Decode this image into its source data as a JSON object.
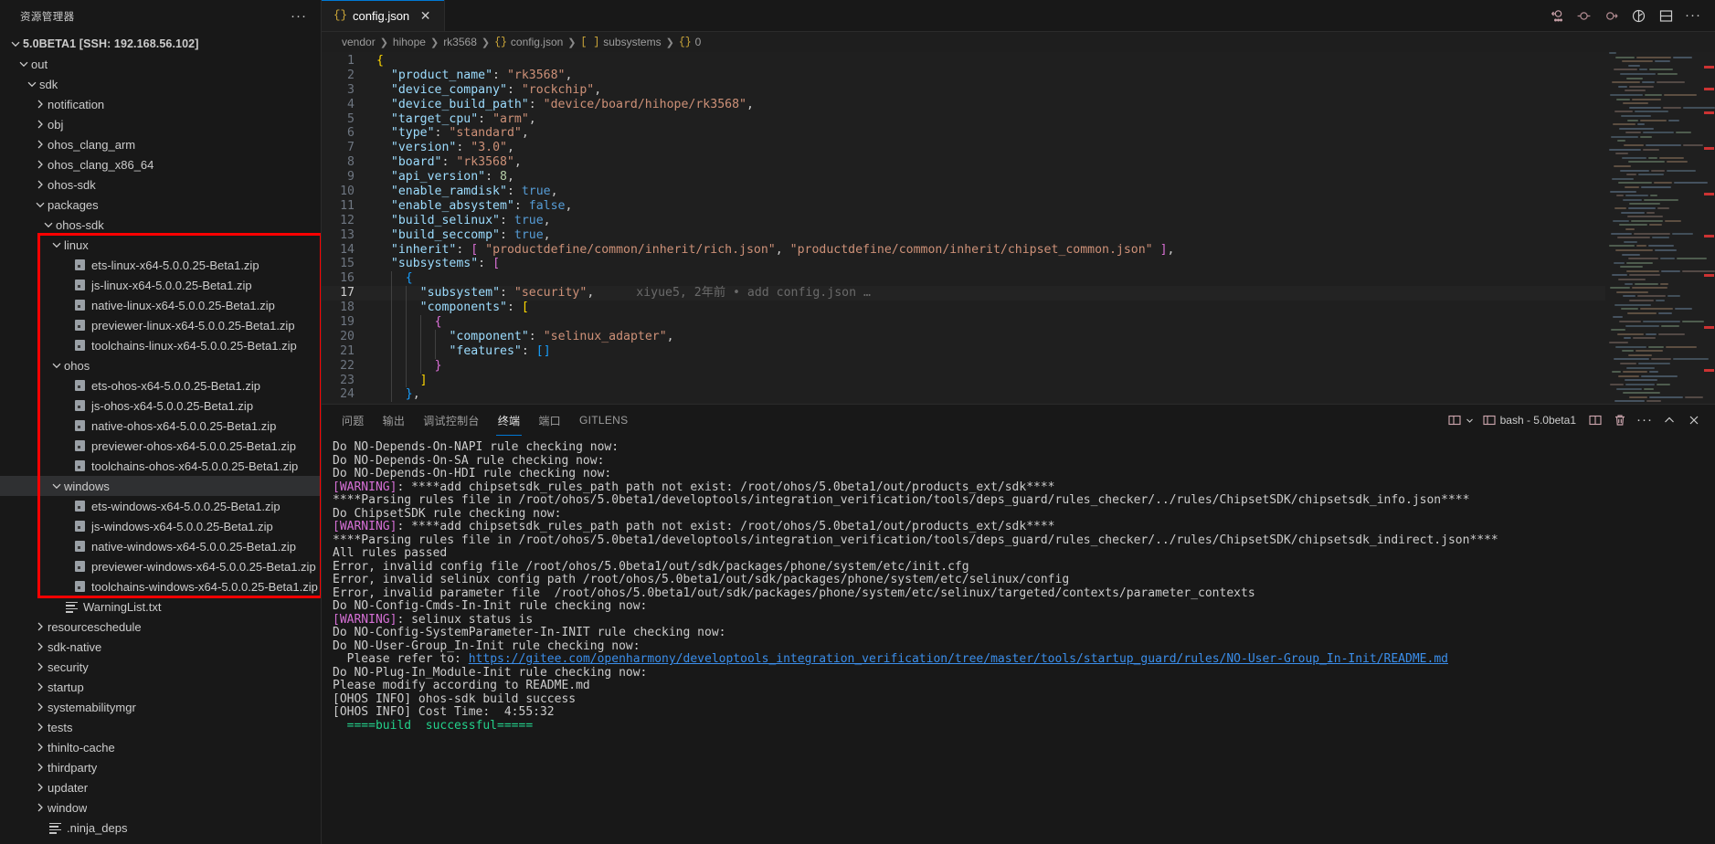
{
  "sidebar": {
    "title": "资源管理器",
    "more_icon": "ellipsis-icon",
    "tree": [
      {
        "label": "5.0BETA1 [SSH: 192.168.56.102]",
        "indent": 0,
        "twist": "down",
        "kind": "root"
      },
      {
        "label": "out",
        "indent": 1,
        "twist": "down",
        "kind": "folder"
      },
      {
        "label": "sdk",
        "indent": 2,
        "twist": "down",
        "kind": "folder"
      },
      {
        "label": "notification",
        "indent": 3,
        "twist": "right",
        "kind": "folder"
      },
      {
        "label": "obj",
        "indent": 3,
        "twist": "right",
        "kind": "folder"
      },
      {
        "label": "ohos_clang_arm",
        "indent": 3,
        "twist": "right",
        "kind": "folder"
      },
      {
        "label": "ohos_clang_x86_64",
        "indent": 3,
        "twist": "right",
        "kind": "folder"
      },
      {
        "label": "ohos-sdk",
        "indent": 3,
        "twist": "right",
        "kind": "folder"
      },
      {
        "label": "packages",
        "indent": 3,
        "twist": "down",
        "kind": "folder"
      },
      {
        "label": "ohos-sdk",
        "indent": 4,
        "twist": "down",
        "kind": "folder"
      },
      {
        "label": "linux",
        "indent": 5,
        "twist": "down",
        "kind": "folder"
      },
      {
        "label": "ets-linux-x64-5.0.0.25-Beta1.zip",
        "indent": 6,
        "twist": "none",
        "kind": "zip"
      },
      {
        "label": "js-linux-x64-5.0.0.25-Beta1.zip",
        "indent": 6,
        "twist": "none",
        "kind": "zip"
      },
      {
        "label": "native-linux-x64-5.0.0.25-Beta1.zip",
        "indent": 6,
        "twist": "none",
        "kind": "zip"
      },
      {
        "label": "previewer-linux-x64-5.0.0.25-Beta1.zip",
        "indent": 6,
        "twist": "none",
        "kind": "zip"
      },
      {
        "label": "toolchains-linux-x64-5.0.0.25-Beta1.zip",
        "indent": 6,
        "twist": "none",
        "kind": "zip"
      },
      {
        "label": "ohos",
        "indent": 5,
        "twist": "down",
        "kind": "folder"
      },
      {
        "label": "ets-ohos-x64-5.0.0.25-Beta1.zip",
        "indent": 6,
        "twist": "none",
        "kind": "zip"
      },
      {
        "label": "js-ohos-x64-5.0.0.25-Beta1.zip",
        "indent": 6,
        "twist": "none",
        "kind": "zip"
      },
      {
        "label": "native-ohos-x64-5.0.0.25-Beta1.zip",
        "indent": 6,
        "twist": "none",
        "kind": "zip"
      },
      {
        "label": "previewer-ohos-x64-5.0.0.25-Beta1.zip",
        "indent": 6,
        "twist": "none",
        "kind": "zip"
      },
      {
        "label": "toolchains-ohos-x64-5.0.0.25-Beta1.zip",
        "indent": 6,
        "twist": "none",
        "kind": "zip"
      },
      {
        "label": "windows",
        "indent": 5,
        "twist": "down",
        "kind": "folder",
        "selected": true
      },
      {
        "label": "ets-windows-x64-5.0.0.25-Beta1.zip",
        "indent": 6,
        "twist": "none",
        "kind": "zip"
      },
      {
        "label": "js-windows-x64-5.0.0.25-Beta1.zip",
        "indent": 6,
        "twist": "none",
        "kind": "zip"
      },
      {
        "label": "native-windows-x64-5.0.0.25-Beta1.zip",
        "indent": 6,
        "twist": "none",
        "kind": "zip"
      },
      {
        "label": "previewer-windows-x64-5.0.0.25-Beta1.zip",
        "indent": 6,
        "twist": "none",
        "kind": "zip"
      },
      {
        "label": "toolchains-windows-x64-5.0.0.25-Beta1.zip",
        "indent": 6,
        "twist": "none",
        "kind": "zip"
      },
      {
        "label": "WarningList.txt",
        "indent": 5,
        "twist": "none",
        "kind": "text"
      },
      {
        "label": "resourceschedule",
        "indent": 3,
        "twist": "right",
        "kind": "folder"
      },
      {
        "label": "sdk-native",
        "indent": 3,
        "twist": "right",
        "kind": "folder"
      },
      {
        "label": "security",
        "indent": 3,
        "twist": "right",
        "kind": "folder"
      },
      {
        "label": "startup",
        "indent": 3,
        "twist": "right",
        "kind": "folder"
      },
      {
        "label": "systemabilitymgr",
        "indent": 3,
        "twist": "right",
        "kind": "folder"
      },
      {
        "label": "tests",
        "indent": 3,
        "twist": "right",
        "kind": "folder"
      },
      {
        "label": "thinlto-cache",
        "indent": 3,
        "twist": "right",
        "kind": "folder"
      },
      {
        "label": "thirdparty",
        "indent": 3,
        "twist": "right",
        "kind": "folder"
      },
      {
        "label": "updater",
        "indent": 3,
        "twist": "right",
        "kind": "folder"
      },
      {
        "label": "window",
        "indent": 3,
        "twist": "right",
        "kind": "folder"
      },
      {
        "label": ".ninja_deps",
        "indent": 3,
        "twist": "none",
        "kind": "text"
      }
    ],
    "annotation_color": "#ff0000"
  },
  "tabbar": {
    "tabs": [
      {
        "label": "config.json",
        "icon": "json-braces-icon",
        "close_icon": "close-icon",
        "active": true
      }
    ],
    "left_more_icon": "ellipsis-icon",
    "actions": [
      {
        "name": "gitlens-commit-graph-icon"
      },
      {
        "name": "run-icon"
      },
      {
        "name": "step-icon"
      },
      {
        "name": "debug-icon"
      },
      {
        "name": "split-editor-icon"
      },
      {
        "name": "editor-more-icon"
      }
    ]
  },
  "breadcrumb": {
    "items": [
      {
        "label": "vendor",
        "icon": ""
      },
      {
        "label": "hihope",
        "icon": ""
      },
      {
        "label": "rk3568",
        "icon": ""
      },
      {
        "label": "config.json",
        "icon": "{}"
      },
      {
        "label": "subsystems",
        "icon": "[ ]"
      },
      {
        "label": "0",
        "icon": "{}"
      }
    ],
    "separator": "❯"
  },
  "editor": {
    "active_line": 17,
    "blame": "xiyue5, 2年前 • add config.json …",
    "lines": [
      {
        "n": 1,
        "tokens": [
          {
            "t": "{",
            "c": "brc"
          }
        ]
      },
      {
        "n": 2,
        "indent": 1,
        "tokens": [
          {
            "t": "\"product_name\"",
            "c": "k"
          },
          {
            "t": ": ",
            "c": "p"
          },
          {
            "t": "\"rk3568\"",
            "c": "s"
          },
          {
            "t": ",",
            "c": "p"
          }
        ]
      },
      {
        "n": 3,
        "indent": 1,
        "tokens": [
          {
            "t": "\"device_company\"",
            "c": "k"
          },
          {
            "t": ": ",
            "c": "p"
          },
          {
            "t": "\"rockchip\"",
            "c": "s"
          },
          {
            "t": ",",
            "c": "p"
          }
        ]
      },
      {
        "n": 4,
        "indent": 1,
        "tokens": [
          {
            "t": "\"device_build_path\"",
            "c": "k"
          },
          {
            "t": ": ",
            "c": "p"
          },
          {
            "t": "\"device/board/hihope/rk3568\"",
            "c": "s"
          },
          {
            "t": ",",
            "c": "p"
          }
        ]
      },
      {
        "n": 5,
        "indent": 1,
        "tokens": [
          {
            "t": "\"target_cpu\"",
            "c": "k"
          },
          {
            "t": ": ",
            "c": "p"
          },
          {
            "t": "\"arm\"",
            "c": "s"
          },
          {
            "t": ",",
            "c": "p"
          }
        ]
      },
      {
        "n": 6,
        "indent": 1,
        "tokens": [
          {
            "t": "\"type\"",
            "c": "k"
          },
          {
            "t": ": ",
            "c": "p"
          },
          {
            "t": "\"standard\"",
            "c": "s"
          },
          {
            "t": ",",
            "c": "p"
          }
        ]
      },
      {
        "n": 7,
        "indent": 1,
        "tokens": [
          {
            "t": "\"version\"",
            "c": "k"
          },
          {
            "t": ": ",
            "c": "p"
          },
          {
            "t": "\"3.0\"",
            "c": "s"
          },
          {
            "t": ",",
            "c": "p"
          }
        ]
      },
      {
        "n": 8,
        "indent": 1,
        "tokens": [
          {
            "t": "\"board\"",
            "c": "k"
          },
          {
            "t": ": ",
            "c": "p"
          },
          {
            "t": "\"rk3568\"",
            "c": "s"
          },
          {
            "t": ",",
            "c": "p"
          }
        ]
      },
      {
        "n": 9,
        "indent": 1,
        "tokens": [
          {
            "t": "\"api_version\"",
            "c": "k"
          },
          {
            "t": ": ",
            "c": "p"
          },
          {
            "t": "8",
            "c": "n"
          },
          {
            "t": ",",
            "c": "p"
          }
        ]
      },
      {
        "n": 10,
        "indent": 1,
        "tokens": [
          {
            "t": "\"enable_ramdisk\"",
            "c": "k"
          },
          {
            "t": ": ",
            "c": "p"
          },
          {
            "t": "true",
            "c": "b"
          },
          {
            "t": ",",
            "c": "p"
          }
        ]
      },
      {
        "n": 11,
        "indent": 1,
        "tokens": [
          {
            "t": "\"enable_absystem\"",
            "c": "k"
          },
          {
            "t": ": ",
            "c": "p"
          },
          {
            "t": "false",
            "c": "b"
          },
          {
            "t": ",",
            "c": "p"
          }
        ]
      },
      {
        "n": 12,
        "indent": 1,
        "tokens": [
          {
            "t": "\"build_selinux\"",
            "c": "k"
          },
          {
            "t": ": ",
            "c": "p"
          },
          {
            "t": "true",
            "c": "b"
          },
          {
            "t": ",",
            "c": "p"
          }
        ]
      },
      {
        "n": 13,
        "indent": 1,
        "tokens": [
          {
            "t": "\"build_seccomp\"",
            "c": "k"
          },
          {
            "t": ": ",
            "c": "p"
          },
          {
            "t": "true",
            "c": "b"
          },
          {
            "t": ",",
            "c": "p"
          }
        ]
      },
      {
        "n": 14,
        "indent": 1,
        "tokens": [
          {
            "t": "\"inherit\"",
            "c": "k"
          },
          {
            "t": ": ",
            "c": "p"
          },
          {
            "t": "[",
            "c": "brc2"
          },
          {
            "t": " ",
            "c": "p"
          },
          {
            "t": "\"productdefine/common/inherit/rich.json\"",
            "c": "s"
          },
          {
            "t": ", ",
            "c": "p"
          },
          {
            "t": "\"productdefine/common/inherit/chipset_common.json\"",
            "c": "s"
          },
          {
            "t": " ",
            "c": "p"
          },
          {
            "t": "]",
            "c": "brc2"
          },
          {
            "t": ",",
            "c": "p"
          }
        ]
      },
      {
        "n": 15,
        "indent": 1,
        "tokens": [
          {
            "t": "\"subsystems\"",
            "c": "k"
          },
          {
            "t": ": ",
            "c": "p"
          },
          {
            "t": "[",
            "c": "brc2"
          }
        ]
      },
      {
        "n": 16,
        "indent": 2,
        "tokens": [
          {
            "t": "{",
            "c": "brc3"
          }
        ]
      },
      {
        "n": 17,
        "indent": 3,
        "tokens": [
          {
            "t": "\"subsystem\"",
            "c": "k"
          },
          {
            "t": ": ",
            "c": "p"
          },
          {
            "t": "\"security\"",
            "c": "s"
          },
          {
            "t": ",",
            "c": "p"
          }
        ]
      },
      {
        "n": 18,
        "indent": 3,
        "tokens": [
          {
            "t": "\"components\"",
            "c": "k"
          },
          {
            "t": ": ",
            "c": "p"
          },
          {
            "t": "[",
            "c": "brc"
          }
        ]
      },
      {
        "n": 19,
        "indent": 4,
        "tokens": [
          {
            "t": "{",
            "c": "brc2"
          }
        ]
      },
      {
        "n": 20,
        "indent": 5,
        "tokens": [
          {
            "t": "\"component\"",
            "c": "k"
          },
          {
            "t": ": ",
            "c": "p"
          },
          {
            "t": "\"selinux_adapter\"",
            "c": "s"
          },
          {
            "t": ",",
            "c": "p"
          }
        ]
      },
      {
        "n": 21,
        "indent": 5,
        "tokens": [
          {
            "t": "\"features\"",
            "c": "k"
          },
          {
            "t": ": ",
            "c": "p"
          },
          {
            "t": "[]",
            "c": "brc3"
          }
        ]
      },
      {
        "n": 22,
        "indent": 4,
        "tokens": [
          {
            "t": "}",
            "c": "brc2"
          }
        ]
      },
      {
        "n": 23,
        "indent": 3,
        "tokens": [
          {
            "t": "]",
            "c": "brc"
          }
        ]
      },
      {
        "n": 24,
        "indent": 2,
        "tokens": [
          {
            "t": "}",
            "c": "brc3"
          },
          {
            "t": ",",
            "c": "p"
          }
        ]
      }
    ]
  },
  "panel": {
    "tabs": [
      {
        "label": "问题",
        "active": false
      },
      {
        "label": "输出",
        "active": false
      },
      {
        "label": "调试控制台",
        "active": false
      },
      {
        "label": "终端",
        "active": true
      },
      {
        "label": "端口",
        "active": false
      },
      {
        "label": "GITLENS",
        "active": false
      }
    ],
    "terminal_name": "bash - 5.0beta1",
    "actions": [
      {
        "name": "panel-layout-icon"
      },
      {
        "name": "chevron-down-icon"
      },
      {
        "name": "terminal-icon"
      },
      {
        "name": "split-terminal-icon"
      },
      {
        "name": "trash-icon"
      },
      {
        "name": "views-more-icon"
      },
      {
        "name": "maximize-panel-icon"
      },
      {
        "name": "close-panel-icon"
      }
    ]
  },
  "terminal": {
    "lines": [
      {
        "segs": [
          {
            "t": "Do NO-Depends-On-NAPI rule checking now:",
            "c": ""
          }
        ]
      },
      {
        "segs": [
          {
            "t": "Do NO-Depends-On-SA rule checking now:",
            "c": ""
          }
        ]
      },
      {
        "segs": [
          {
            "t": "Do NO-Depends-On-HDI rule checking now:",
            "c": ""
          }
        ]
      },
      {
        "segs": [
          {
            "t": "[WARNING]",
            "c": "w"
          },
          {
            "t": ": ****add chipsetsdk_rules_path path not exist: /root/ohos/5.0beta1/out/products_ext/sdk****",
            "c": ""
          }
        ]
      },
      {
        "segs": [
          {
            "t": "****Parsing rules file in /root/ohos/5.0beta1/developtools/integration_verification/tools/deps_guard/rules_checker/../rules/ChipsetSDK/chipsetsdk_info.json****",
            "c": ""
          }
        ]
      },
      {
        "segs": [
          {
            "t": "Do ChipsetSDK rule checking now:",
            "c": ""
          }
        ]
      },
      {
        "segs": [
          {
            "t": "[WARNING]",
            "c": "w"
          },
          {
            "t": ": ****add chipsetsdk_rules_path path not exist: /root/ohos/5.0beta1/out/products_ext/sdk****",
            "c": ""
          }
        ]
      },
      {
        "segs": [
          {
            "t": "****Parsing rules file in /root/ohos/5.0beta1/developtools/integration_verification/tools/deps_guard/rules_checker/../rules/ChipsetSDK/chipsetsdk_indirect.json****",
            "c": ""
          }
        ]
      },
      {
        "segs": [
          {
            "t": "All rules passed",
            "c": ""
          }
        ]
      },
      {
        "segs": [
          {
            "t": "Error, invalid config file /root/ohos/5.0beta1/out/sdk/packages/phone/system/etc/init.cfg",
            "c": ""
          }
        ]
      },
      {
        "segs": [
          {
            "t": "Error, invalid selinux config path /root/ohos/5.0beta1/out/sdk/packages/phone/system/etc/selinux/config",
            "c": ""
          }
        ]
      },
      {
        "segs": [
          {
            "t": "Error, invalid parameter file  /root/ohos/5.0beta1/out/sdk/packages/phone/system/etc/selinux/targeted/contexts/parameter_contexts",
            "c": ""
          }
        ]
      },
      {
        "segs": [
          {
            "t": "Do NO-Config-Cmds-In-Init rule checking now:",
            "c": ""
          }
        ]
      },
      {
        "segs": [
          {
            "t": "[WARNING]",
            "c": "w"
          },
          {
            "t": ": selinux status is",
            "c": ""
          }
        ]
      },
      {
        "segs": [
          {
            "t": "Do NO-Config-SystemParameter-In-INIT rule checking now:",
            "c": ""
          }
        ]
      },
      {
        "segs": [
          {
            "t": "Do NO-User-Group_In-Init rule checking now:",
            "c": ""
          }
        ]
      },
      {
        "segs": [
          {
            "t": "  Please refer to: ",
            "c": ""
          },
          {
            "t": "https://gitee.com/openharmony/developtools_integration_verification/tree/master/tools/startup_guard/rules/NO-User-Group_In-Init/README.md",
            "c": "lnk"
          }
        ]
      },
      {
        "segs": [
          {
            "t": "Do NO-Plug-In_Module-Init rule checking now:",
            "c": ""
          }
        ]
      },
      {
        "segs": [
          {
            "t": "Please modify according to README.md",
            "c": ""
          }
        ]
      },
      {
        "segs": [
          {
            "t": "[OHOS INFO] ohos-sdk build success",
            "c": ""
          }
        ]
      },
      {
        "segs": [
          {
            "t": "[OHOS INFO] Cost Time:  4:55:32",
            "c": ""
          }
        ]
      },
      {
        "segs": [
          {
            "t": "  ====build  successful=====",
            "c": "grn"
          }
        ]
      }
    ]
  }
}
